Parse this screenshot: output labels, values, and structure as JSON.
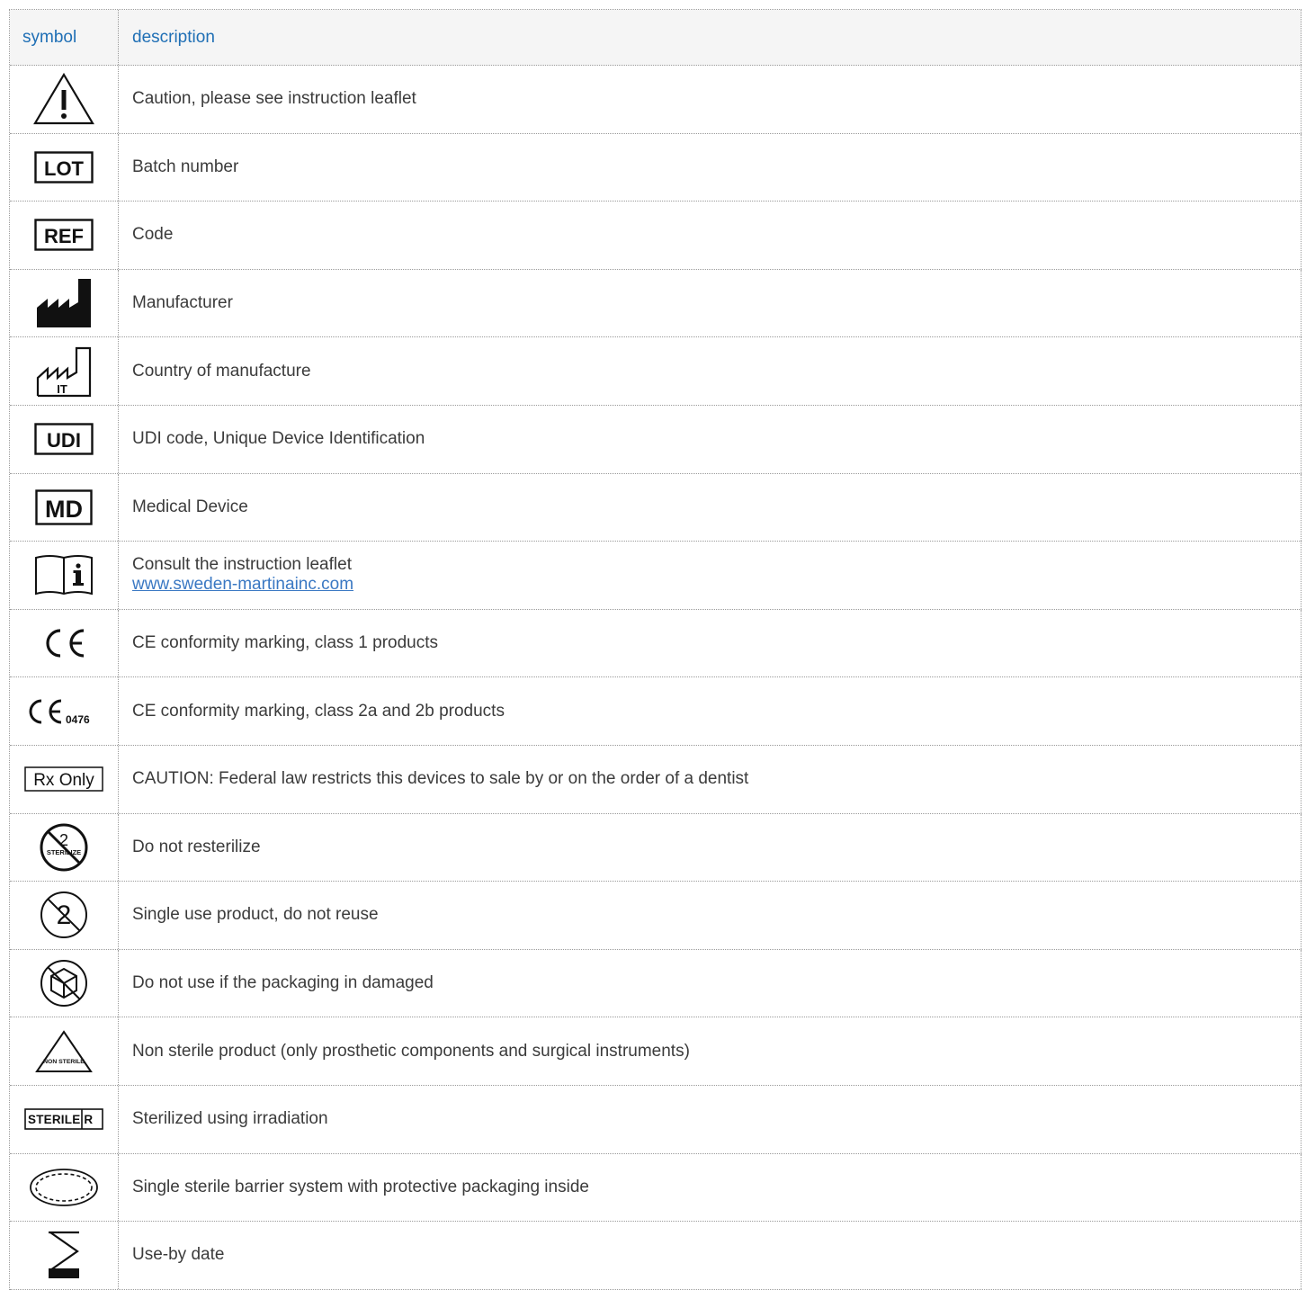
{
  "header": {
    "symbol": "symbol",
    "description": "description"
  },
  "rows": [
    {
      "icon": "caution-icon",
      "description": "Caution, please see instruction leaflet"
    },
    {
      "icon": "lot-icon",
      "description": "Batch number",
      "mark": "LOT"
    },
    {
      "icon": "ref-icon",
      "description": "Code",
      "mark": "REF"
    },
    {
      "icon": "manufacturer-icon",
      "description": "Manufacturer"
    },
    {
      "icon": "country-of-manufacture-icon",
      "description": "Country of manufacture",
      "mark": "IT"
    },
    {
      "icon": "udi-icon",
      "description": "UDI code, Unique Device Identification",
      "mark": "UDI"
    },
    {
      "icon": "md-icon",
      "description": "Medical Device",
      "mark": "MD"
    },
    {
      "icon": "consult-leaflet-icon",
      "description": "Consult the instruction leaflet",
      "link": "www.sweden-martinainc.com"
    },
    {
      "icon": "ce-icon",
      "description": "CE conformity marking, class 1 products"
    },
    {
      "icon": "ce-0476-icon",
      "description": "CE conformity marking, class 2a and 2b products",
      "mark": "0476"
    },
    {
      "icon": "rx-only-icon",
      "description": "CAUTION: Federal law restricts this devices to sale by or on the order of a dentist",
      "mark": "Rx Only"
    },
    {
      "icon": "do-not-resterilize-icon",
      "description": "Do not resterilize",
      "mark": "STERILIZE"
    },
    {
      "icon": "single-use-icon",
      "description": "Single use product, do not reuse"
    },
    {
      "icon": "damaged-packaging-icon",
      "description": "Do not use if the packaging in damaged"
    },
    {
      "icon": "non-sterile-icon",
      "description": "Non sterile product (only prosthetic components and surgical instruments)",
      "mark": "NON STERILE"
    },
    {
      "icon": "sterile-r-icon",
      "description": "Sterilized using irradiation",
      "mark": "STERILE R"
    },
    {
      "icon": "sterile-barrier-icon",
      "description": "Single sterile barrier system with protective packaging inside"
    },
    {
      "icon": "use-by-date-icon",
      "description": "Use-by date"
    }
  ]
}
